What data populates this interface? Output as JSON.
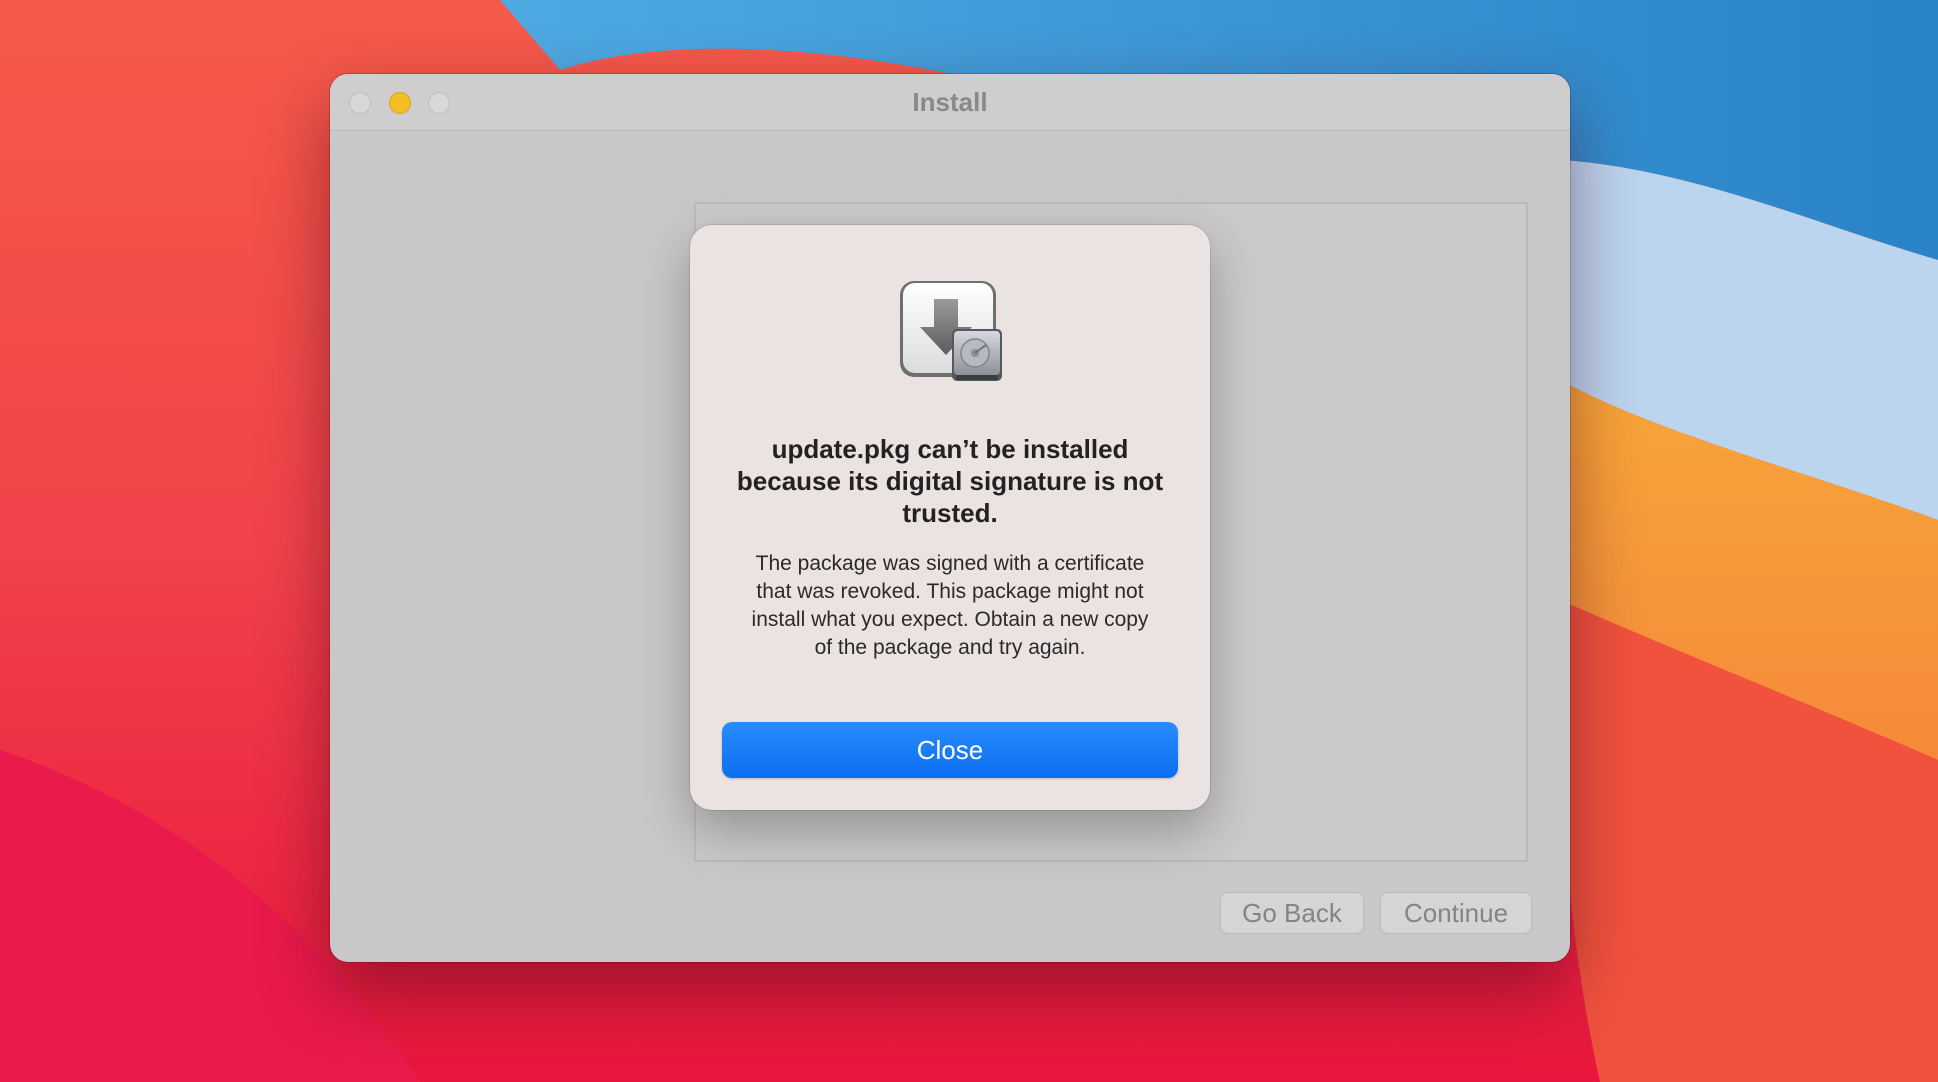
{
  "window": {
    "title": "Install",
    "go_back_label": "Go Back",
    "continue_label": "Continue"
  },
  "alert": {
    "icon": "installer-package-icon",
    "title": "update.pkg can’t be installed because its digital signature is not trusted.",
    "message": "The package was signed with a certificate that was revoked. This package might not install what you expect. Obtain a new copy of the package and try again.",
    "button_label": "Close"
  },
  "colors": {
    "accent": "#0a72f2",
    "minimize": "#f5bd24"
  }
}
